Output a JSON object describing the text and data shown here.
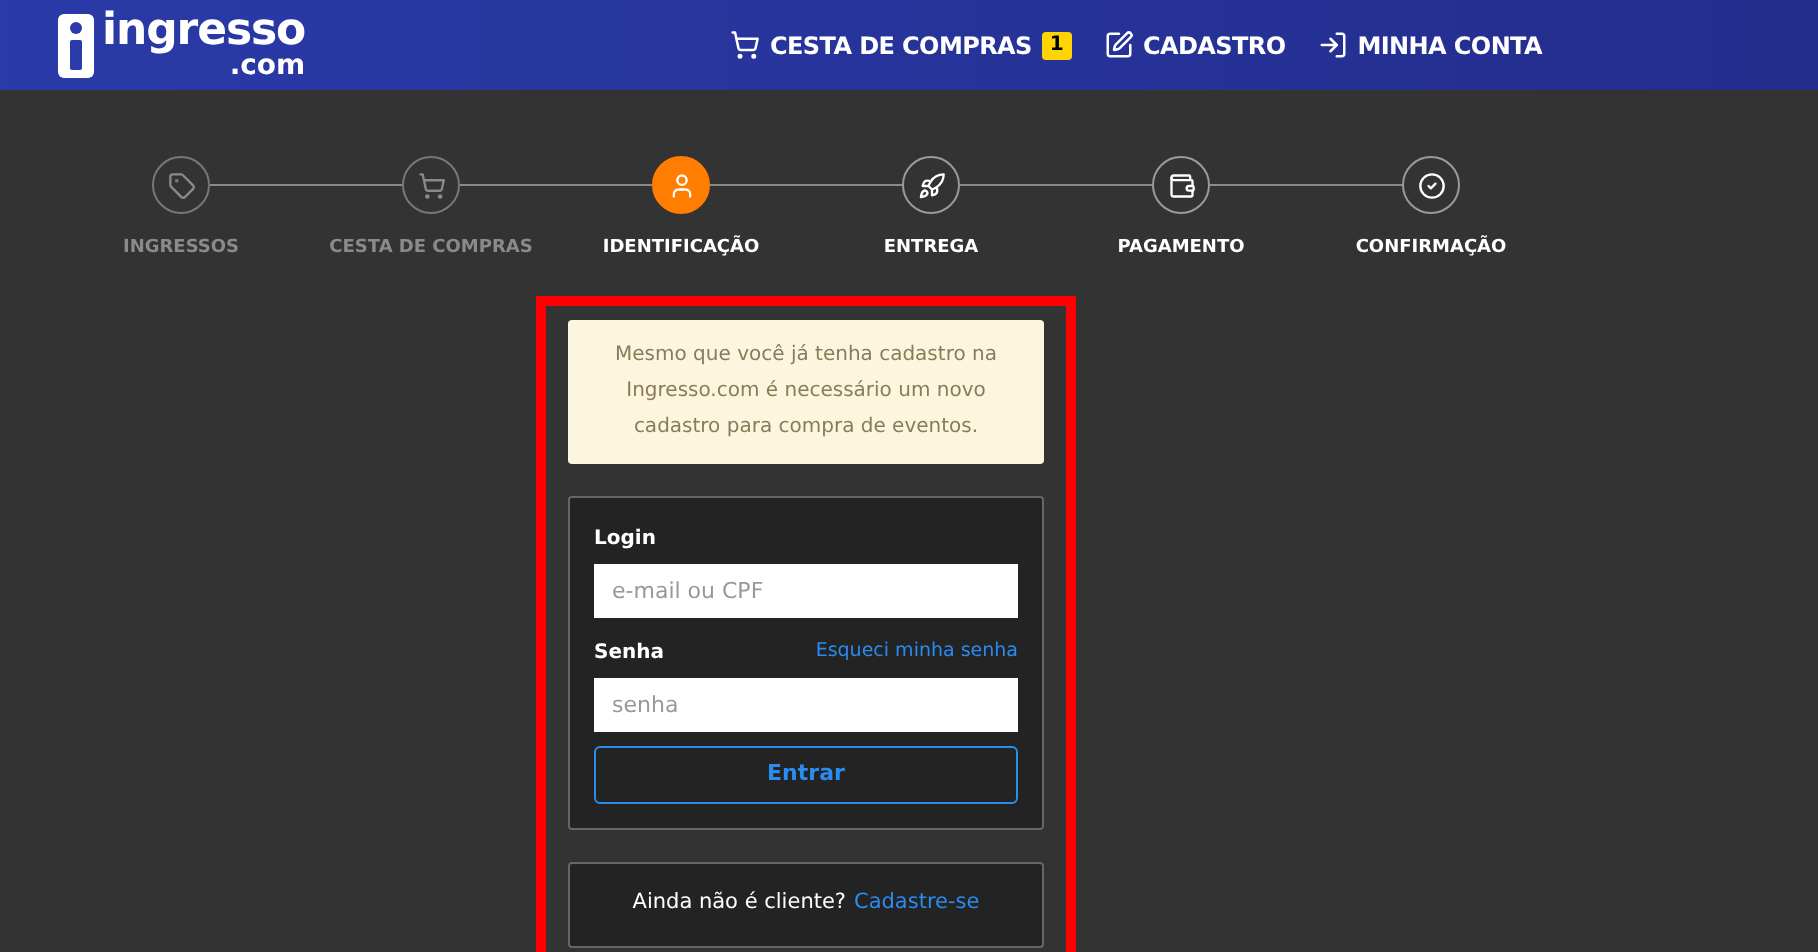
{
  "header": {
    "logo": {
      "name": "ingresso",
      "suffix": ".com"
    },
    "nav": [
      {
        "kind": "cart",
        "label": "CESTA DE COMPRAS",
        "badge": "1"
      },
      {
        "kind": "edit",
        "label": "CADASTRO"
      },
      {
        "kind": "login",
        "label": "MINHA CONTA"
      }
    ]
  },
  "steps": [
    {
      "kind": "tag",
      "label": "INGRESSOS",
      "completed": true,
      "selected": false
    },
    {
      "kind": "cart",
      "label": "CESTA DE COMPRAS",
      "completed": true,
      "selected": false
    },
    {
      "kind": "user",
      "label": "IDENTIFICAÇÃO",
      "completed": false,
      "selected": true
    },
    {
      "kind": "rocket",
      "label": "ENTREGA",
      "completed": false,
      "selected": false
    },
    {
      "kind": "wallet",
      "label": "PAGAMENTO",
      "completed": false,
      "selected": false
    },
    {
      "kind": "check",
      "label": "CONFIRMAÇÃO",
      "completed": false,
      "selected": false
    }
  ],
  "notice": "Mesmo que você já tenha cadastro na Ingresso.com é necessário um novo cadastro para compra de eventos.",
  "login_form": {
    "login_label": "Login",
    "login_placeholder": "e-mail ou CPF",
    "password_label": "Senha",
    "forgot_link": "Esqueci minha senha",
    "password_placeholder": "senha",
    "submit": "Entrar"
  },
  "signup": {
    "text": "Ainda não é cliente?",
    "link": "Cadastre-se"
  }
}
